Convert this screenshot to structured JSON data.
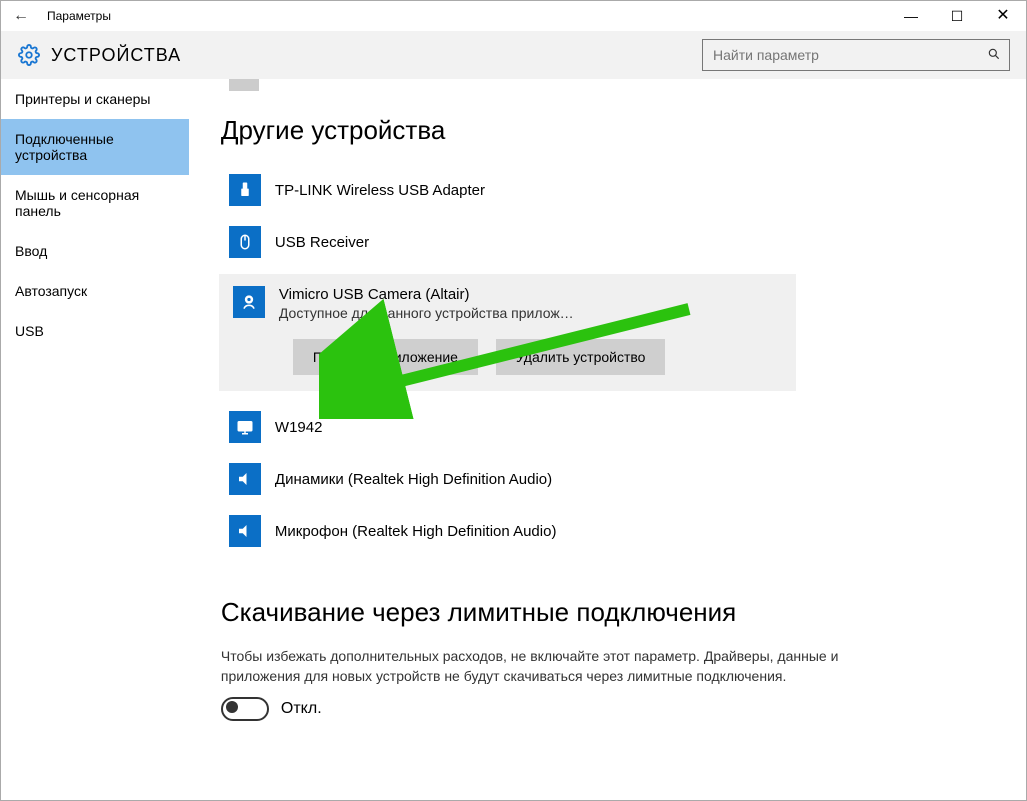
{
  "window": {
    "title": "Параметры"
  },
  "titlebar": {
    "back_glyph": "←",
    "min_glyph": "—",
    "max_glyph": "☐",
    "close_glyph": "✕"
  },
  "header": {
    "title": "УСТРОЙСТВА",
    "search_placeholder": "Найти параметр"
  },
  "sidebar": {
    "items": [
      {
        "label": "Принтеры и сканеры"
      },
      {
        "label": "Подключенные устройства",
        "selected": true
      },
      {
        "label": "Мышь и сенсорная панель"
      },
      {
        "label": "Ввод"
      },
      {
        "label": "Автозапуск"
      },
      {
        "label": "USB"
      }
    ]
  },
  "section_other": {
    "title": "Другие устройства"
  },
  "devices": [
    {
      "name": "TP-LINK Wireless USB Adapter",
      "icon": "usb"
    },
    {
      "name": "USB Receiver",
      "icon": "mouse"
    }
  ],
  "selected_device": {
    "name": "Vimicro USB Camera (Altair)",
    "subtitle": "Доступное для данного устройства прилож…",
    "get_app": "Получить приложение",
    "remove": "Удалить устройство"
  },
  "devices_after": [
    {
      "name": "W1942",
      "icon": "monitor"
    },
    {
      "name": "Динамики (Realtek High Definition Audio)",
      "icon": "speaker"
    },
    {
      "name": "Микрофон (Realtek High Definition Audio)",
      "icon": "speaker"
    }
  ],
  "section_metered": {
    "title": "Скачивание через лимитные подключения",
    "desc": "Чтобы избежать дополнительных расходов, не включайте этот параметр. Драйверы, данные и приложения для новых устройств не будут скачиваться через лимитные подключения.",
    "toggle_label": "Откл."
  }
}
